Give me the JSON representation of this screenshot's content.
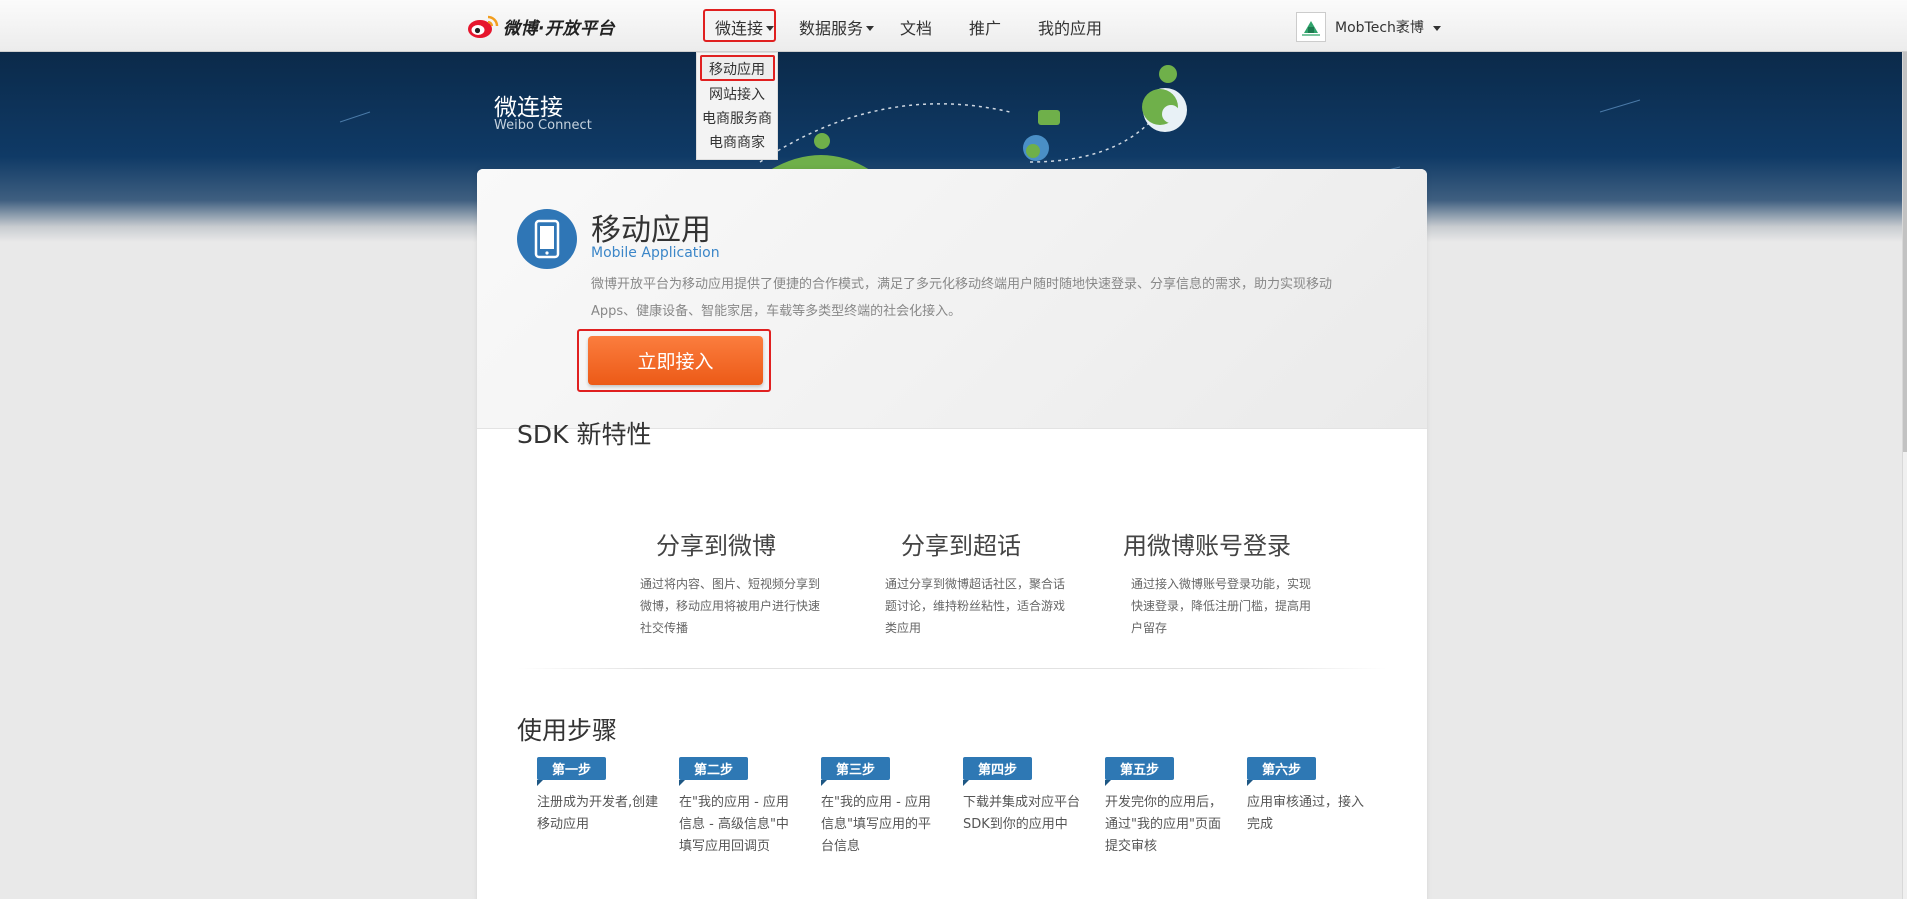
{
  "nav": {
    "brand": "微博·开放平台",
    "items": [
      {
        "label": "微连接",
        "has_caret": true
      },
      {
        "label": "数据服务",
        "has_caret": true
      },
      {
        "label": "文档",
        "has_caret": false
      },
      {
        "label": "推广",
        "has_caret": false
      },
      {
        "label": "我的应用",
        "has_caret": false
      }
    ],
    "user_name": "MobTech袤博"
  },
  "dropdown": {
    "items": [
      "移动应用",
      "网站接入",
      "电商服务商",
      "电商商家"
    ]
  },
  "banner": {
    "title": "微连接",
    "subtitle": "Weibo Connect"
  },
  "hero": {
    "icon": "mobile-phone-icon",
    "title": "移动应用",
    "subtitle": "Mobile Application",
    "description": "微博开放平台为移动应用提供了便捷的合作模式，满足了多元化移动终端用户随时随地快速登录、分享信息的需求，助力实现移动Apps、健康设备、智能家居，车载等多类型终端的社会化接入。",
    "cta_label": "立即接入"
  },
  "sdk": {
    "title": "SDK 新特性",
    "features": [
      {
        "title": "分享到微博",
        "desc": "通过将内容、图片、短视频分享到微博，移动应用将被用户进行快速社交传播"
      },
      {
        "title": "分享到超话",
        "desc": "通过分享到微博超话社区，聚合话题讨论，维持粉丝粘性，适合游戏类应用"
      },
      {
        "title": "用微博账号登录",
        "desc": "通过接入微博账号登录功能，实现快速登录，降低注册门槛，提高用户留存"
      }
    ]
  },
  "steps": {
    "title": "使用步骤",
    "items": [
      {
        "tag": "第一步",
        "desc": "注册成为开发者,创建移动应用"
      },
      {
        "tag": "第二步",
        "desc": "在\"我的应用 - 应用信息 - 高级信息\"中填写应用回调页"
      },
      {
        "tag": "第三步",
        "desc": "在\"我的应用 - 应用信息\"填写应用的平台信息"
      },
      {
        "tag": "第四步",
        "desc": "下载并集成对应平台SDK到你的应用中"
      },
      {
        "tag": "第五步",
        "desc": "开发完你的应用后，通过\"我的应用\"页面提交审核"
      },
      {
        "tag": "第六步",
        "desc": "应用审核通过，接入完成"
      }
    ]
  },
  "colors": {
    "accent": "#2f76b6",
    "cta": "#f26a22",
    "highlight": "#e02020",
    "banner": "#0f3a66"
  }
}
